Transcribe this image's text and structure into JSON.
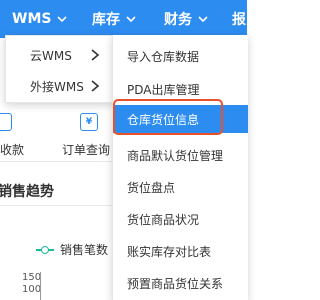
{
  "topbar": {
    "nav": [
      {
        "label": "WMS"
      },
      {
        "label": "库存"
      },
      {
        "label": "财务"
      },
      {
        "label": "报"
      }
    ]
  },
  "background": {
    "shortcut_left_label": "收款",
    "shortcut_right_label": "订单查询",
    "shortcut_right_icon_glyph": "¥",
    "section_title": "销售趋势",
    "legend_label": "销售笔数",
    "y_ticks": [
      "150",
      "100"
    ]
  },
  "menu_level1": {
    "items": [
      {
        "label": "云WMS"
      },
      {
        "label": "外接WMS"
      }
    ]
  },
  "menu_level2": {
    "active_index": 2,
    "items": [
      {
        "label": "导入仓库数据"
      },
      {
        "label": "PDA出库管理"
      },
      {
        "label": "仓库货位信息"
      },
      {
        "label": "商品默认货位管理"
      },
      {
        "label": "货位盘点"
      },
      {
        "label": "货位商品状况"
      },
      {
        "label": "账实库存对比表"
      },
      {
        "label": "预置商品货位关系"
      }
    ]
  },
  "colors": {
    "topbar": "#2d8cf0",
    "active_item": "#2d8cf0",
    "highlight_border": "#e8512a",
    "legend_series": "#1abc9c"
  }
}
